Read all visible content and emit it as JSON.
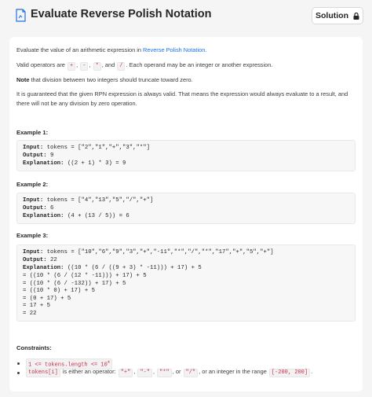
{
  "header": {
    "title": "Evaluate Reverse Polish Notation",
    "solution_label": "Solution"
  },
  "description": {
    "p1_prefix": "Evaluate the value of an arithmetic expression in ",
    "p1_link": "Reverse Polish Notation",
    "p1_suffix": ".",
    "p2_prefix": "Valid operators are ",
    "ops": [
      "+",
      "-",
      "*",
      "/"
    ],
    "p2_and": ", and ",
    "p2_comma": ", ",
    "p2_suffix": ". Each operand may be an integer or another expression.",
    "p3_bold": "Note",
    "p3_rest": " that division between two integers should truncate toward zero.",
    "p4_line1": "It is guaranteed that the given RPN expression is always valid. That means the expression would always evaluate to a result, and",
    "p4_line2": "there will not be any division by zero operation."
  },
  "examples": [
    {
      "title": "Example 1:",
      "input": "tokens = [\"2\",\"1\",\"+\",\"3\",\"*\"]",
      "output": "9",
      "explanation": "((2 + 1) * 3) = 9",
      "extra": []
    },
    {
      "title": "Example 2:",
      "input": "tokens = [\"4\",\"13\",\"5\",\"/\",\"+\"]",
      "output": "6",
      "explanation": "(4 + (13 / 5)) = 6",
      "extra": []
    },
    {
      "title": "Example 3:",
      "input": "tokens = [\"10\",\"6\",\"9\",\"3\",\"+\",\"-11\",\"*\",\"/\",\"*\",\"17\",\"+\",\"5\",\"+\"]",
      "output": "22",
      "explanation": "((10 * (6 / ((9 + 3) * -11))) + 17) + 5",
      "extra": [
        "= ((10 * (6 / (12 * -11))) + 17) + 5",
        "= ((10 * (6 / -132)) + 17) + 5",
        "= ((10 * 0) + 17) + 5",
        "= (0 + 17) + 5",
        "= 17 + 5",
        "= 22"
      ]
    }
  ],
  "labels": {
    "input": "Input:",
    "output": "Output:",
    "explanation": "Explanation:"
  },
  "constraints": {
    "title": "Constraints:",
    "c1_code": "1 <= tokens.length <= 10",
    "c1_exp": "4",
    "c2_code": "tokens[i]",
    "c2_mid": " is either an operator: ",
    "c2_ops": [
      "\"+\"",
      "\"-\"",
      "\"*\"",
      "\"/\""
    ],
    "c2_or": ", or ",
    "c2_rest": ", or an integer in the range ",
    "c2_range": "[-200, 200]",
    "c2_end": "."
  },
  "colors": {
    "accent_link": "#1a73e8",
    "inline_code": "#cc2b4a"
  }
}
